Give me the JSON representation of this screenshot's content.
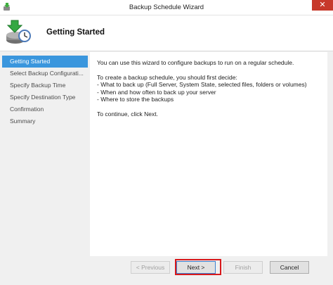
{
  "window": {
    "title": "Backup Schedule Wizard",
    "close_glyph": "✕",
    "app_icon": "backup-app-icon",
    "close_color": "#c7392b"
  },
  "header": {
    "title": "Getting Started",
    "icon": "backup-schedule-clock-icon"
  },
  "sidebar": {
    "items": [
      {
        "label": "Getting Started",
        "active": true
      },
      {
        "label": "Select Backup Configurati...",
        "active": false
      },
      {
        "label": "Specify Backup Time",
        "active": false
      },
      {
        "label": "Specify Destination Type",
        "active": false
      },
      {
        "label": "Confirmation",
        "active": false
      },
      {
        "label": "Summary",
        "active": false
      }
    ],
    "active_color": "#3a96dd"
  },
  "content": {
    "intro": "You can use this wizard to configure backups to run on a regular schedule.",
    "decide_heading": "To create a backup schedule, you should first decide:",
    "bullets": [
      "- What to back up (Full Server, System State, selected files, folders or volumes)",
      "- When and how often to back up your server",
      "- Where to store the backups"
    ],
    "continue_text": "To continue, click Next."
  },
  "buttons": {
    "previous": "< Previous",
    "next": "Next >",
    "finish": "Finish",
    "cancel": "Cancel"
  },
  "annotation": {
    "highlight_color": "#d8191c"
  }
}
